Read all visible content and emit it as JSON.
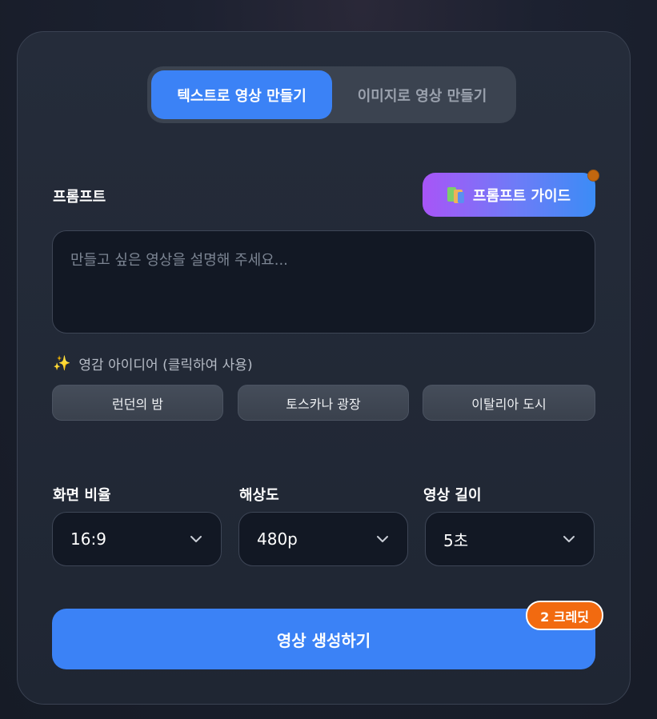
{
  "tabs": [
    {
      "label": "텍스트로 영상 만들기",
      "active": true
    },
    {
      "label": "이미지로 영상 만들기",
      "active": false
    }
  ],
  "prompt": {
    "label": "프롬프트",
    "placeholder": "만들고 싶은 영상을 설명해 주세요...",
    "value": ""
  },
  "guide_button": {
    "label": "프롬프트 가이드",
    "icon": "books-icon"
  },
  "ideas": {
    "title": "영감 아이디어 (클릭하여 사용)",
    "icon": "sparkles-icon",
    "items": [
      "런던의 밤",
      "토스카나 광장",
      "이탈리아 도시"
    ]
  },
  "settings": {
    "aspect_ratio": {
      "label": "화면 비율",
      "value": "16:9"
    },
    "resolution": {
      "label": "해상도",
      "value": "480p"
    },
    "duration": {
      "label": "영상 길이",
      "value": "5초"
    }
  },
  "generate": {
    "label": "영상 생성하기",
    "credit_badge": "2 크레딧"
  },
  "colors": {
    "accent": "#3b82f6",
    "badge": "#f26a10",
    "guide_gradient_start": "#a855f7",
    "guide_gradient_end": "#3b8cf6"
  }
}
